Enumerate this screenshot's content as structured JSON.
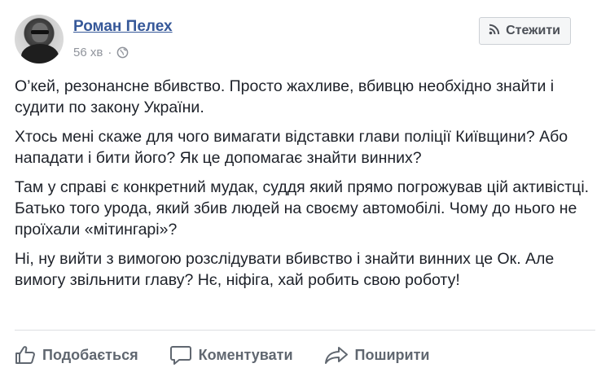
{
  "post": {
    "author": "Роман Пелех",
    "time": "56 хв",
    "separator": "·",
    "follow_label": "Стежити",
    "paragraphs": [
      "О’кей, резонансне вбивство. Просто жахливе, вбивцю необхідно знайти і судити по закону України.",
      "Хтось мені скаже для чого вимагати відставки глави поліції Київщини? Або нападати і бити його? Як це допомагає знайти винних?",
      "Там у справі є конкретний мудак, суддя який прямо погрожував цій активістці. Батько того урода, який збив людей на своєму автомобілі. Чому до нього не проїхали «мітингарі»?",
      "Ні, ну вийти з вимогою розслідувати вбивство і знайти винних це Ок. Але вимогу звільнити главу? Нє, ніфіга, хай робить свою роботу!"
    ]
  },
  "actions": {
    "like_label": "Подобається",
    "comment_label": "Коментувати",
    "share_label": "Поширити"
  },
  "colors": {
    "author_link": "#365899",
    "meta_text": "#90949c",
    "action_text": "#606770",
    "body_text": "#1d2129"
  },
  "icons": {
    "privacy": "globe-icon",
    "follow": "rss-icon",
    "like": "thumbs-up-icon",
    "comment": "comment-bubble-icon",
    "share": "share-arrow-icon"
  }
}
